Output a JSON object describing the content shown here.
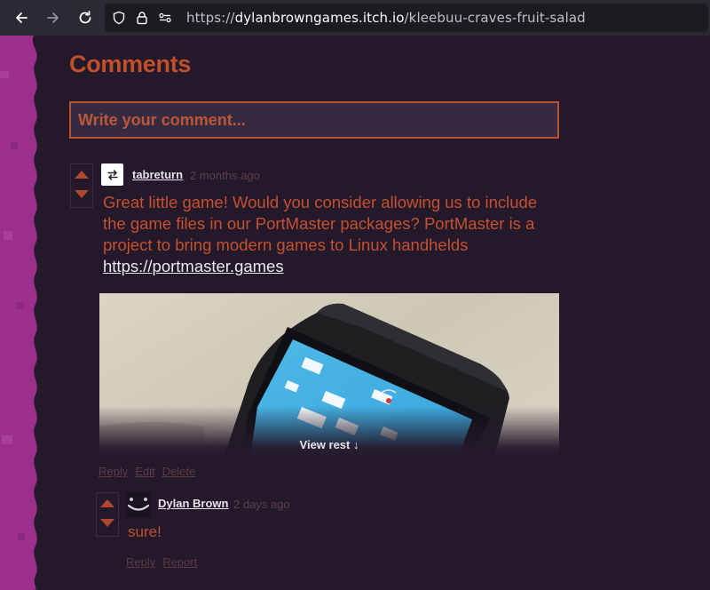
{
  "browser": {
    "url_prefix": "https://",
    "url_host": "dylanbrowngames.itch.io",
    "url_path": "/kleebuu-craves-fruit-salad"
  },
  "comments_section": {
    "heading": "Comments",
    "input_placeholder": "Write your comment..."
  },
  "comments": [
    {
      "author": "tabreturn",
      "time": "2 months ago",
      "body": "Great little game! Would you consider allowing us to include the game files in our PortMaster packages? PortMaster is a project to bring modern games to Linux handhelds ",
      "link_text": "https://portmaster.games",
      "view_rest": "View rest ↓",
      "actions": [
        "Reply",
        "Edit",
        "Delete"
      ]
    }
  ],
  "replies": [
    {
      "author": "Dylan Brown",
      "time": "2 days ago",
      "body": "sure!",
      "actions": [
        "Reply",
        "Report"
      ]
    }
  ],
  "colors": {
    "accent": "#c1502a",
    "page_bg": "#24192b",
    "side_bg": "#9c2f8b"
  }
}
